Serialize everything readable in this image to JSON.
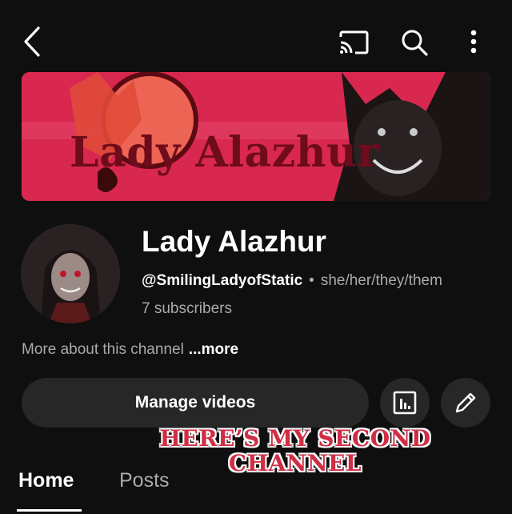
{
  "topbar": {
    "icons": [
      "back-arrow-icon",
      "cast-icon",
      "search-icon",
      "more-vert-icon"
    ]
  },
  "banner": {
    "title": "Lady Alazhur",
    "background_color": "#d9284f",
    "title_color": "#6e0c1b"
  },
  "channel": {
    "name": "Lady Alazhur",
    "handle": "@SmilingLadyofStatic",
    "separator": "•",
    "pronouns": "she/her/they/them",
    "subscribers": "7 subscribers",
    "about_text": "More about this channel",
    "about_more": "...more"
  },
  "actions": {
    "manage_videos": "Manage videos",
    "analytics_icon": "analytics-icon",
    "edit_icon": "edit-pencil-icon"
  },
  "overlay_text": {
    "line1": "HERE’S MY SECOND",
    "line2": "CHANNEL",
    "color": "#cf2e46"
  },
  "tabs": [
    {
      "label": "Home",
      "selected": true
    },
    {
      "label": "Posts",
      "selected": false
    }
  ],
  "colors": {
    "background": "#0f0f0f",
    "button_bg": "#272727",
    "secondary_text": "#aaaaaa"
  }
}
